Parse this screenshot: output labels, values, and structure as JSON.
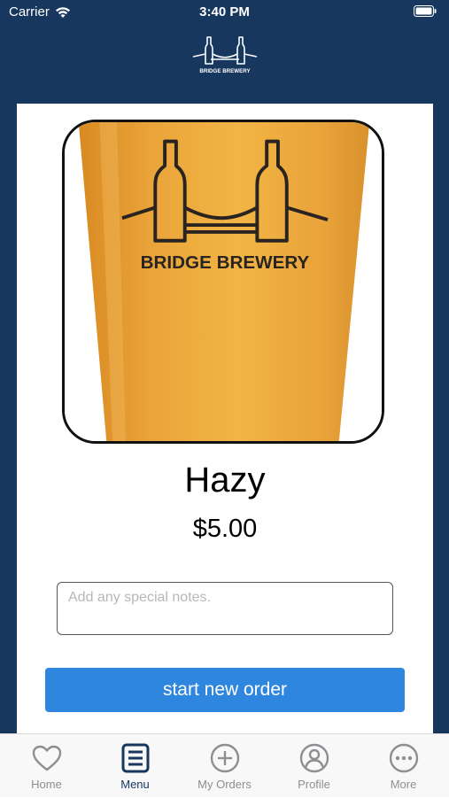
{
  "status_bar": {
    "carrier": "Carrier",
    "time": "3:40 PM"
  },
  "brand": {
    "name": "BRIDGE BREWERY"
  },
  "product": {
    "image_logo_text": "BRIDGE BREWERY",
    "name": "Hazy",
    "price": "$5.00"
  },
  "notes": {
    "placeholder": "Add any special notes.",
    "value": ""
  },
  "actions": {
    "start_order_label": "start new order"
  },
  "tabs": [
    {
      "label": "Home",
      "icon": "heart-icon",
      "active": false
    },
    {
      "label": "Menu",
      "icon": "menu-list-icon",
      "active": true
    },
    {
      "label": "My Orders",
      "icon": "plus-circle-icon",
      "active": false
    },
    {
      "label": "Profile",
      "icon": "profile-icon",
      "active": false
    },
    {
      "label": "More",
      "icon": "more-icon",
      "active": false
    }
  ],
  "colors": {
    "header_background": "#17375e",
    "primary_button": "#2f86de",
    "active_tab": "#17375e",
    "inactive_tab": "#8e8e93"
  }
}
